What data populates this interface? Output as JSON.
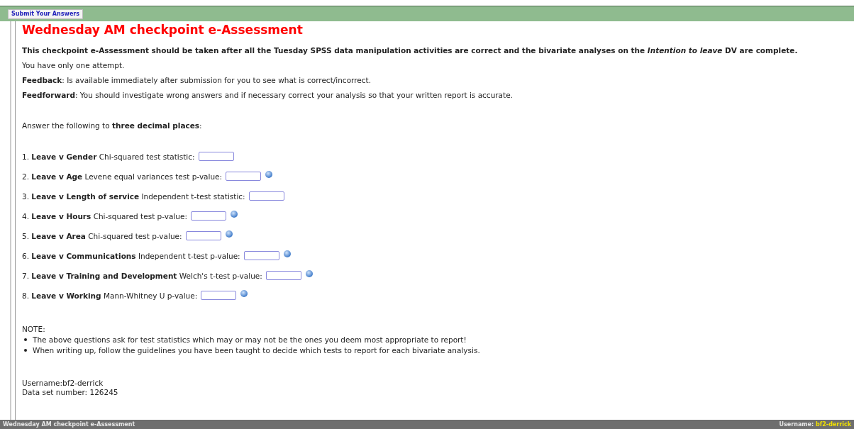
{
  "toolbar": {
    "submit_button": "Submit Your Answers"
  },
  "title": "Wednesday AM checkpoint e-Assessment",
  "intro": "This checkpoint e-Assessment should be taken after all the Tuesday SPSS data manipulation activities are correct and the bivariate analyses on the *Intention to leave* DV are complete.",
  "paragraphs": [
    "You have only one attempt.",
    "**Feedback**: Is available immediately after submission for you to see what is correct/incorrect.",
    "**Feedforward**: You should investigate wrong answers and if necessary correct your analysis so that your written report is accurate."
  ],
  "instruction": "Answer the following to **three decimal places**:",
  "questions": [
    {
      "label": "1. **Leave v Gender** Chi-squared test statistic:",
      "help_icon": false
    },
    {
      "label": "2. **Leave v Age** Levene equal variances test p-value:",
      "help_icon": true
    },
    {
      "label": "3. **Leave v Length of service** Independent t-test statistic:",
      "help_icon": false
    },
    {
      "label": "4. **Leave v Hours** Chi-squared test p-value:",
      "help_icon": true
    },
    {
      "label": "5. **Leave v Area** Chi-squared test p-value:",
      "help_icon": true
    },
    {
      "label": "6. **Leave v Communications** Independent t-test p-value:",
      "help_icon": true
    },
    {
      "label": "7. **Leave v Training and Development** Welch's t-test p-value:",
      "help_icon": true
    },
    {
      "label": "8. **Leave v Working** Mann-Whitney U p-value:",
      "help_icon": true
    }
  ],
  "note": {
    "heading": "NOTE:",
    "items": [
      "The above questions ask for test statistics which may or may not be the ones you deem most appropriate to report!",
      "When writing up, follow the guidelines you have been taught to decide which tests to report for each bivariate analysis."
    ]
  },
  "user_info": [
    "Username:bf2-derrick",
    "Data set number: 126245"
  ],
  "status_bar": {
    "title": "Wednesday AM checkpoint e-Assessment",
    "username_label": "Username:",
    "username": "bf2-derrick"
  }
}
